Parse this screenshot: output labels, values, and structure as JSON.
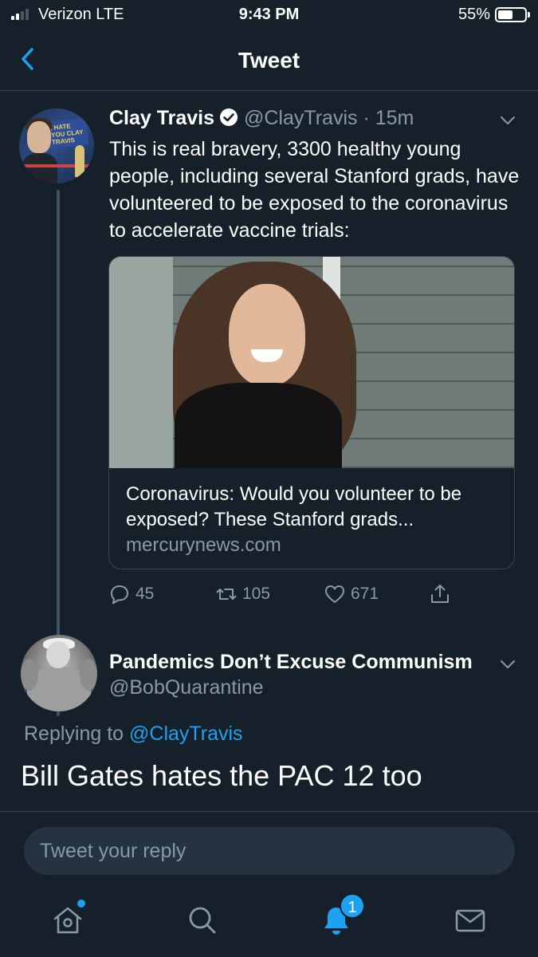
{
  "status_bar": {
    "carrier": "Verizon  LTE",
    "time": "9:43 PM",
    "battery": "55%"
  },
  "nav": {
    "title": "Tweet",
    "back_icon": "chevron-left-icon"
  },
  "tweet": {
    "name": "Clay Travis",
    "handle": "@ClayTravis",
    "time": "· 15m",
    "text": "This is real bravery, 3300 healthy young people, including several Stanford grads, have volunteered to be exposed to the coronavirus to accelerate vaccine trials:",
    "avatar_sign": "I HATE YOU CLAY TRAVIS",
    "card": {
      "title": "Coronavirus: Would you volunteer to be exposed? These Stanford grads...",
      "domain": "mercurynews.com"
    },
    "actions": {
      "replies": "45",
      "retweets": "105",
      "likes": "671"
    }
  },
  "reply": {
    "name": "Pandemics Don’t Excuse Communism",
    "handle": "@BobQuarantine",
    "replying_to_label": "Replying to",
    "replying_to_handle": "@ClayTravis",
    "text": "Bill Gates hates the PAC 12 too"
  },
  "compose": {
    "placeholder": "Tweet your reply"
  },
  "tab_bar": {
    "notification_count": "1",
    "icons": [
      "home-icon",
      "search-icon",
      "notifications-icon",
      "messages-icon"
    ]
  },
  "colors": {
    "background": "#15202b",
    "accent": "#1da1f2",
    "secondary_text": "#8899a6",
    "divider": "#38444d"
  }
}
